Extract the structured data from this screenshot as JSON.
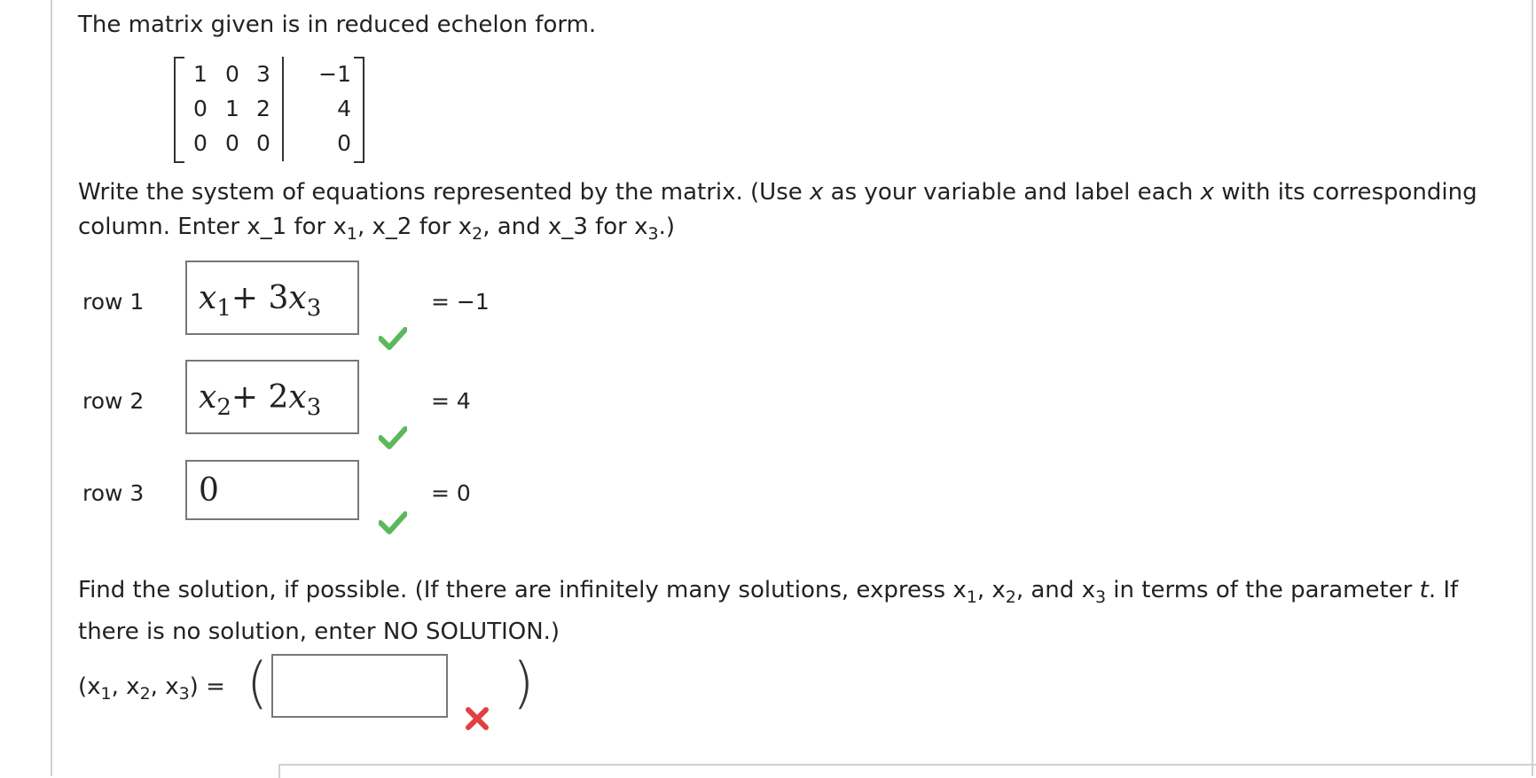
{
  "intro_text": "The matrix given is in reduced echelon form.",
  "matrix": {
    "rows": [
      [
        "1",
        "0",
        "3",
        "−1"
      ],
      [
        "0",
        "1",
        "2",
        "4"
      ],
      [
        "0",
        "0",
        "0",
        "0"
      ]
    ]
  },
  "instructions": {
    "line1_a": "Write the system of equations represented by the matrix. (Use ",
    "line1_var": "x",
    "line1_b": " as your variable and label each ",
    "line1_c": " with its corresponding",
    "line2_a": "column. Enter x_1 for ",
    "line2_b": ", x_2 for ",
    "line2_c": ", and x_3 for ",
    "line2_d": ".)",
    "sub1": "1",
    "sub2": "2",
    "sub3": "3",
    "x_upright": "x"
  },
  "rows": [
    {
      "label": "row 1",
      "answer_a": "x",
      "answer_a_sub": "1",
      "answer_b": " + 3",
      "answer_c": "x",
      "answer_c_sub": "3",
      "rhs": "= −1",
      "status": "correct"
    },
    {
      "label": "row 2",
      "answer_a": "x",
      "answer_a_sub": "2",
      "answer_b": " + 2",
      "answer_c": "x",
      "answer_c_sub": "3",
      "rhs": "= 4",
      "status": "correct"
    },
    {
      "label": "row 3",
      "answer": "0",
      "rhs": "= 0",
      "status": "correct"
    }
  ],
  "find": {
    "line1_a": "Find the solution, if possible. (If there are infinitely many solutions, express ",
    "line1_b": ", ",
    "line1_c": ", and ",
    "line1_d": " in terms of the parameter ",
    "param": "t",
    "line1_e": ". If",
    "line2": "there is no solution, enter NO SOLUTION.)"
  },
  "tuple": {
    "open": "(",
    "x": "x",
    "comma": ", ",
    "close": ")",
    "equals": " =",
    "value": "",
    "status": "incorrect"
  },
  "colors": {
    "check_green": "#5cb85c",
    "cross_red": "#e0403f"
  }
}
